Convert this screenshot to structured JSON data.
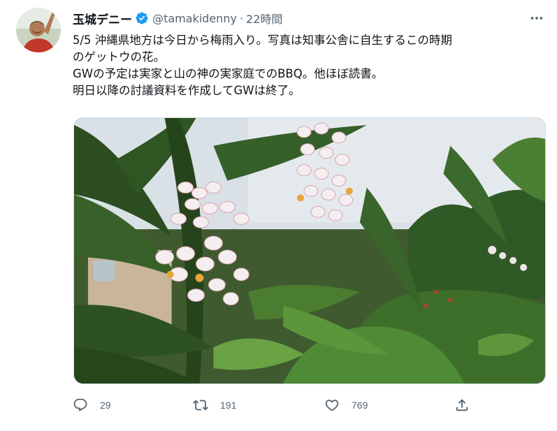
{
  "tweet": {
    "author_name": "玉城デニー",
    "handle": "@tamakidenny",
    "separator": "·",
    "time": "22時間",
    "text_lines": [
      "5/5 沖縄県地方は今日から梅雨入り。写真は知事公舎に自生するこの時期",
      "のゲットウの花。",
      "GWの予定は実家と山の神の実家庭でのBBQ。他ほぼ読書。",
      "明日以降の討議資料を作成してGWは終了。"
    ],
    "media": {
      "description_icon": "photo-ginger-flowers"
    },
    "actions": {
      "reply_count": "29",
      "retweet_count": "191",
      "like_count": "769"
    }
  },
  "colors": {
    "text": "#0f1419",
    "secondary": "#536471",
    "verified": "#1d9bf0",
    "border": "#eff3f4"
  }
}
